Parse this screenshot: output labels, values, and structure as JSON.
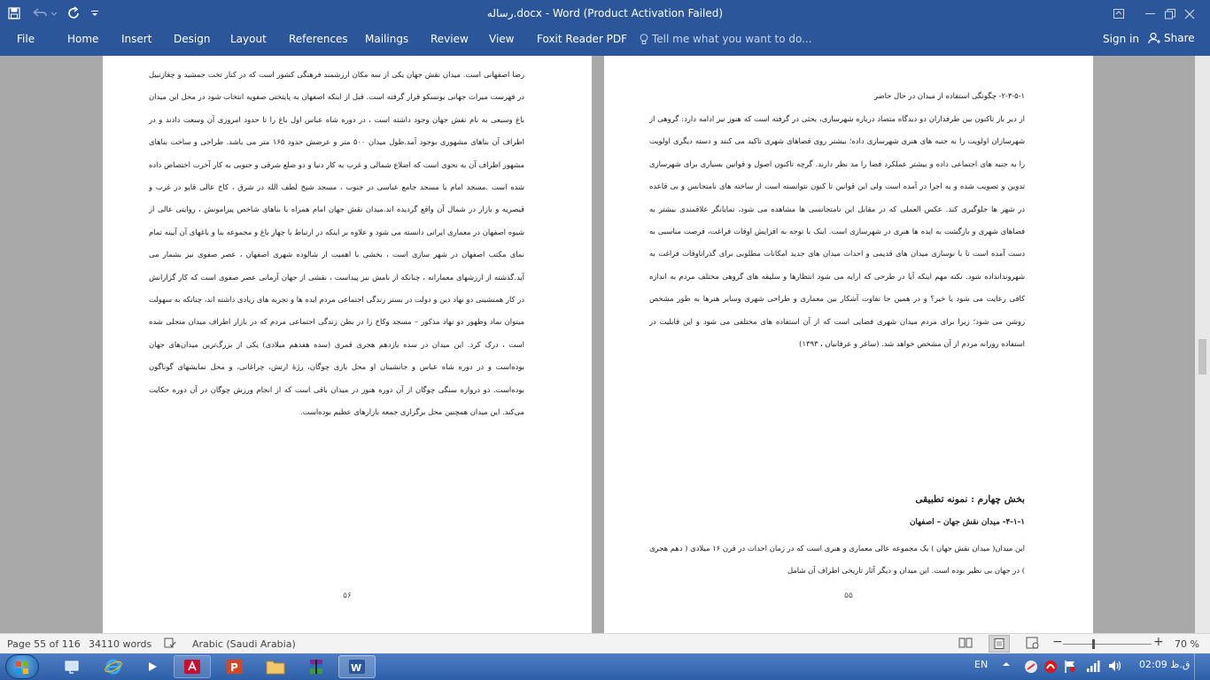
{
  "app": {
    "doc_title": "رساله.docx - Word (Product Activation Failed)"
  },
  "ribbon": {
    "tabs": [
      "File",
      "Home",
      "Insert",
      "Design",
      "Layout",
      "References",
      "Mailings",
      "Review",
      "View",
      "Foxit Reader PDF"
    ],
    "tell_me": "Tell me what you want to do...",
    "sign_in": "Sign in",
    "share": "Share"
  },
  "page_left": {
    "text": "رضا اصفهانی است.  میدان نقش جهان یکی از سه مکان ارزشمند فرهنگی کشور است که در کنار تخت جمشید و چغازنبیل در فهرست میراث جهانی یونسکو قرار گرفته است. قبل از اینکه اصفهان به پایتختی صفویه انتخاب شود در محل این میدان باغ وسیعی به نام نقش جهان وجود داشته است ، در دوره شاه عباس اول باغ را تا حدود امروزی آن وسعت دادند و در اطراف آن بناهای مشهوری بوجود آمد.طول میدان ۵۰۰ متر و عرضش حدود ۱۶۵ متر می باشد. طراحی و ساخت بناهای مشهور اطراف آن به نحوی است که اضلاع شمالی و غرب به کار دنیا و دو ضلع شرقی و جنوبی به کار آخرت اختصاص داده شده است .مسجد امام یا مسجد جامع عباسی در جنوب ، مسجد شیخ لطف الله در شرق ، کاخ عالی قاپو در غرب و قیصریه و بازار در شمال آن واقع گردیده اند.میدان نقش جهان امام همراه با بناهای شاخص پیرامونش ، روایتی عالی از شیوه اصفهان در معماری ایرانی دانسته می شود و علاوه بر اینکه در ارتباط با چهار باغ و مجموعه بنا و باغهای آن آیینه تمام نمای مکتب اصفهان در شهر سازی است ، بخشی با اهمیت از شالوده شهری اصفهان ، عصر صفوی نیز بشمار می آید.گذشته از ارزشهای معمارانه ، چنانکه از نامش نیز پیداست ، نقشی از جهان آرمانی عصر صفوی است که کار گزارانش در کار همنشینی دو نهاد دین و دولت در بستر زندگی اجتماعی مردم ایده ها و تجربه های زیادی داشته اند، چنانکه به سهولت میتوان نماد وظهور دو نهاد مذکور – مسجد وکاخ را در بطن زندگی اجتماعی مردم که در بازار اطراف میدان متجلی شده است ، درک کرد. این میدان در سده یازدهم هجری قمری (سده هفدهم میلادی) یکی از بزرگ‌ترین میدان‌های جهان بوده‌است و در دوره شاه عباس و جانشینان او محل بازی چوگان، رژهٔ ارتش، چراغانی، و محل نمایشهای گوناگون بوده‌است. دو دروازه سنگی چوگان از آن دوره هنوز در میدان باقی است که از انجام ورزش چوگان در آن دوره حکایت می‌کند. این میدان همچنین محل برگزاری جمعه بازارهای عظیم بوده‌است.",
    "page_number": "۵۶"
  },
  "page_right": {
    "heading": "۲-۳-۵-۱- چگونگی استفاده از میدان در حال حاضر",
    "text": "از دیر باز تاکنون بین طرفداران دو دیدگاه متضاد درباره شهرسازی، بحثی در گرفته است که هنوز نیز ادامه دارد: گروهی از شهرسازان اولویت را به جنبه های هنری شهرسازی داده؛ بیشتر روی فضاهای شهری تاکید می کنند و دسته دیگری اولویت را به جنبه های اجتماعی داده و بیشتر عملکرد فضا را مد نظر دارند. گرچه تاکنون اصول و قوانین بسیاری برای شهرسازی تدوین و تصویب شده و به اجرا در آمده است ولی این قوانین تا کنون نتوانسته است از ساخته های نامتجانس و بی قاعده در شهر ها جلوگیری کند. عکس العملی که در مقابل این نامتجانسی ها مشاهده می شود، نمایانگر علاقمندی بیشتر به فضاهای شهری و بازگشت به ایده ها هنری در شهرسازی است. اینک با توجه به افزایش اوقات فراغت، فرصت مناسبی به دست آمده است تا با نوسازی میدان های قدیمی و احداث میدان های جدید امکانات مطلوبی برای گذراناوقات فراغت به شهروندانداده شود. نکته مهم اینکه آیا در طرحی که ارایه می شود انتظارها و سلیقه های گروهی مختلف مردم به اندازه کافی رعایت می شود یا خیر؟ و در همین جا تفاوت آشکار بین معماری و طراحی شهری وسایر هنرها به طور مشخص روشن می شود؛ زیرا برای مردم میدان شهری فضایی است که از آن استفاده های مختلفی می شود و این قابلیت در استفاده روزانه مردم از آن مشخص خواهد شد. (ساغر و عرفانیان ، ۱۳۹۳)",
    "section_title": "بخش چهارم : نمونه تطبیقی",
    "sub_title": "۴-۱-۱- میدان نقش جهان – اصفهان",
    "section_text": "این میدان( میدان نقش جهان ) یک مجموعه عالی معماری و هنری است که در زمان احداث در قرن ۱۶ میلادی ( دهم هجری ) در جهان بی نظیر بوده است. این میدان و دیگر آثار تاریخی اطراف آن شامل",
    "page_number": "۵۵"
  },
  "status_bar": {
    "page": "Page 55 of 116",
    "words": "34110 words",
    "language": "Arabic (Saudi Arabia)",
    "zoom": "70 %",
    "zoom_level_percent": 70
  },
  "taskbar": {
    "lang": "EN",
    "clock": "02:09 ق.ظ"
  },
  "colors": {
    "word_blue": "#2b579a",
    "doc_bg": "#a9a9a9",
    "taskbar": "#2d5fa8"
  }
}
